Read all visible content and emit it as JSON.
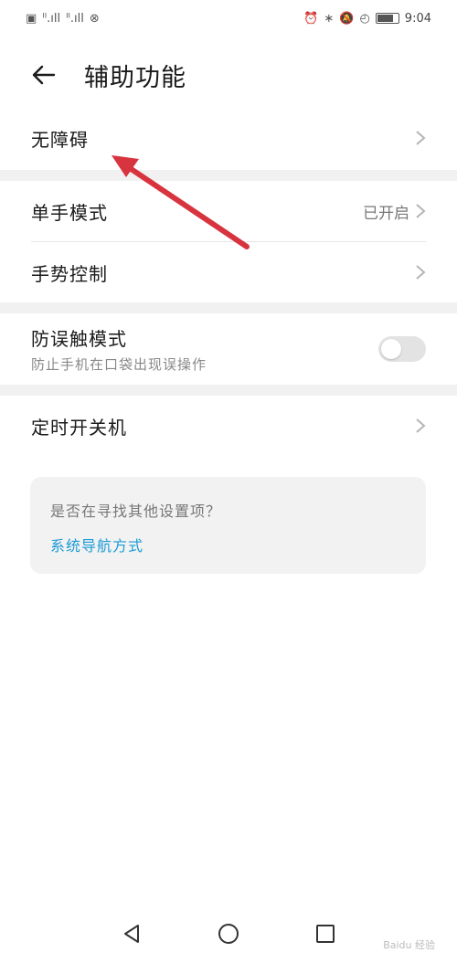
{
  "status_bar": {
    "left_glyphs": [
      "▣",
      "ᴵᴵ.ıll",
      "ᴵᴵ.ıll",
      "⊗"
    ],
    "right_glyphs": [
      "⏰",
      "∗",
      "🔕",
      "◴"
    ],
    "time": "9:04"
  },
  "header": {
    "title": "辅助功能"
  },
  "rows": {
    "accessibility": {
      "label": "无障碍"
    },
    "one_hand": {
      "label": "单手模式",
      "value": "已开启"
    },
    "gesture": {
      "label": "手势控制"
    },
    "pocket_mode": {
      "label": "防误触模式",
      "sub": "防止手机在口袋出现误操作",
      "toggle_on": false
    },
    "scheduled_power": {
      "label": "定时开关机"
    }
  },
  "card": {
    "question": "是否在寻找其他设置项？",
    "link": "系统导航方式"
  },
  "colors": {
    "accent": "#1a9bd7",
    "annotation_arrow": "#d8343f"
  },
  "watermark": "Baidu 经验"
}
